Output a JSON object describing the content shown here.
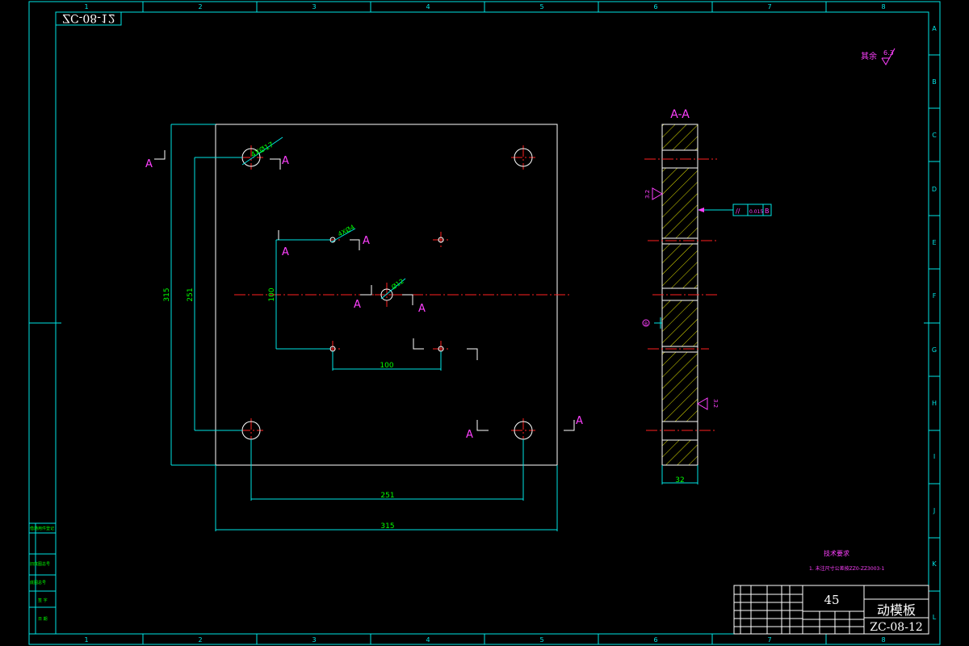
{
  "colors": {
    "background": "#000000",
    "frame": "#00e5e5",
    "part": "#ffffff",
    "dimension": "#00e5e5",
    "dimension_text": "#00ff00",
    "section_label": "#ff40ff",
    "centerline": "#ff2020",
    "hatch": "#e0e000"
  },
  "drawing_number_mirrored": "ZC-08-12",
  "zone_numbers": [
    "1",
    "2",
    "3",
    "4",
    "5",
    "6",
    "7",
    "8"
  ],
  "zone_letters": [
    "A",
    "B",
    "C",
    "D",
    "E",
    "F",
    "G",
    "H",
    "I",
    "J",
    "K",
    "L"
  ],
  "roughness_note": {
    "label": "其余",
    "value": "6.3"
  },
  "section_title": "A-A",
  "section_marker": "A",
  "front_view": {
    "hole_callout_large": "4XØ17",
    "hole_callout_small": "4XØ4",
    "hole_callout_center": "Ø12",
    "dimensions": {
      "overall_height": "315",
      "hole_spacing_height": "251",
      "small_spacing_height": "100",
      "small_spacing_width": "100",
      "hole_spacing_width": "251",
      "overall_width": "315"
    }
  },
  "section_view": {
    "thickness": "32",
    "tolerance_frame": {
      "symbol": "//",
      "value": "0.015",
      "datum": "B"
    },
    "datum_label": "B",
    "roughness_1": "3.2",
    "roughness_2": "3.2"
  },
  "technical_notes": {
    "title": "技术要求",
    "line1": "1. 未注尺寸公差按ZZ0-ZZ3003-1"
  },
  "title_block": {
    "material": "45",
    "part_name": "动模板",
    "drawing_number": "ZC-08-12"
  },
  "left_strip": [
    "借通用件登记",
    "旧底图总号",
    "底图总号",
    "签 字",
    "日 期"
  ]
}
